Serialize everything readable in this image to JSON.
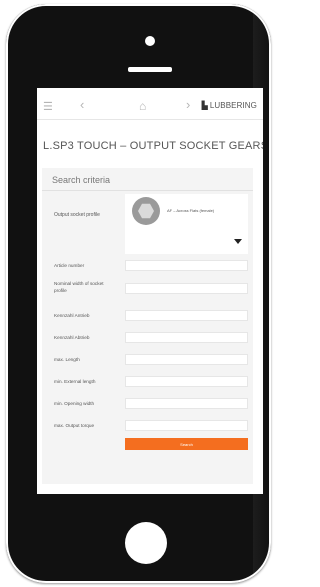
{
  "nav": {
    "menu_icon": "menu-icon",
    "back_icon": "chevron-left-icon",
    "home_icon": "home-icon",
    "forward_icon": "chevron-right-icon",
    "brand": "LUBBERING"
  },
  "page": {
    "title": "L.SP3 TOUCH – OUTPUT SOCKET GEARS"
  },
  "search": {
    "heading": "Search criteria",
    "profile_label": "Output socket profile",
    "profile_value": "AF – Across Flats (female)",
    "fields": [
      {
        "label": "Article number"
      },
      {
        "label": "Nominal width of socket profile"
      },
      {
        "label": "Kennzahl Antrieb"
      },
      {
        "label": "Kennzahl Abtrieb"
      },
      {
        "label": "max. Length"
      },
      {
        "label": "min. External length"
      },
      {
        "label": "min. Opening width"
      },
      {
        "label": "max. Output torque"
      }
    ],
    "button_label": "Search"
  },
  "colors": {
    "accent": "#f46e1f",
    "phone": "#111111"
  }
}
